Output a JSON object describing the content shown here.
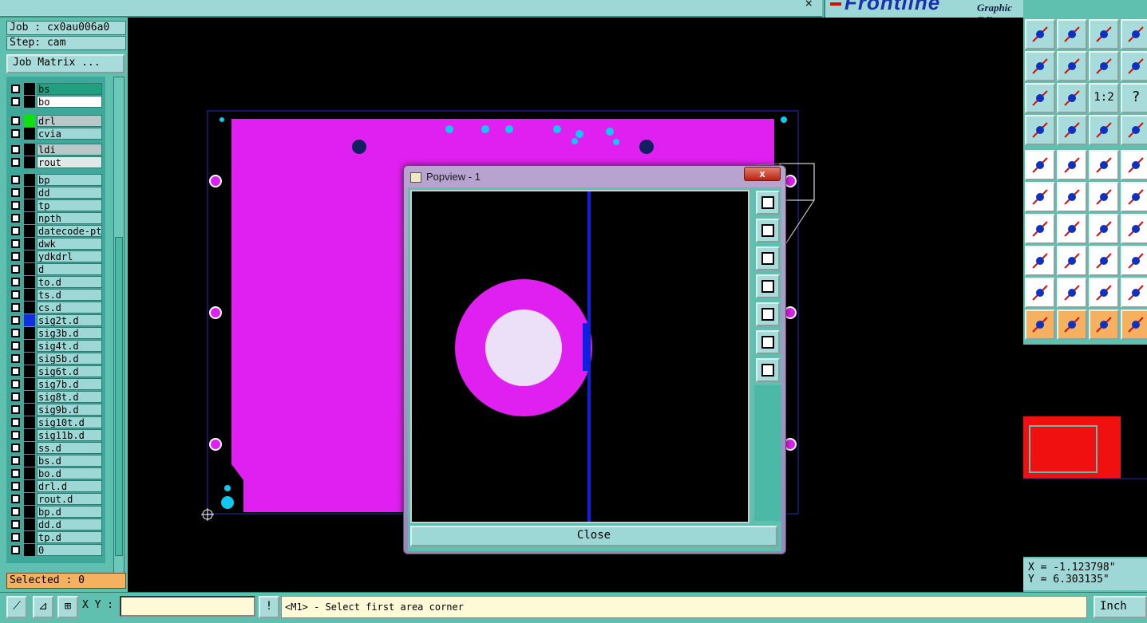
{
  "app": {
    "brand": "Frontline",
    "subtitle": "Graphic Editor",
    "window_close": "×"
  },
  "job": {
    "job_line": "Job : cx0au006a0",
    "step_line": "Step: cam",
    "job_matrix_label": "Job Matrix ..."
  },
  "layers": [
    {
      "name": "bs",
      "color": "#000000",
      "highlight": "#20a080"
    },
    {
      "name": "bo",
      "color": "#000000",
      "highlight": "#ffffff"
    },
    {
      "name": "drl",
      "color": "#10e010",
      "highlight": "#b8c8c8"
    },
    {
      "name": "cvia",
      "color": "#000000",
      "highlight": "#9ed8d6"
    },
    {
      "name": "ldi",
      "color": "#000000",
      "highlight": "#b8c8c8"
    },
    {
      "name": "rout",
      "color": "#000000",
      "highlight": "#e0e8e8"
    },
    {
      "name": "bp",
      "color": "#000000"
    },
    {
      "name": "dd",
      "color": "#000000"
    },
    {
      "name": "tp",
      "color": "#000000"
    },
    {
      "name": "npth",
      "color": "#000000"
    },
    {
      "name": "datecode-ptc",
      "color": "#000000"
    },
    {
      "name": "dwk",
      "color": "#000000"
    },
    {
      "name": "ydkdrl",
      "color": "#000000"
    },
    {
      "name": "d",
      "color": "#000000"
    },
    {
      "name": "to.d",
      "color": "#000000"
    },
    {
      "name": "ts.d",
      "color": "#000000"
    },
    {
      "name": "cs.d",
      "color": "#000000"
    },
    {
      "name": "sig2t.d",
      "color": "#1030e0"
    },
    {
      "name": "sig3b.d",
      "color": "#000000"
    },
    {
      "name": "sig4t.d",
      "color": "#000000"
    },
    {
      "name": "sig5b.d",
      "color": "#000000"
    },
    {
      "name": "sig6t.d",
      "color": "#000000"
    },
    {
      "name": "sig7b.d",
      "color": "#000000"
    },
    {
      "name": "sig8t.d",
      "color": "#000000"
    },
    {
      "name": "sig9b.d",
      "color": "#000000"
    },
    {
      "name": "sig10t.d",
      "color": "#000000"
    },
    {
      "name": "sig11b.d",
      "color": "#000000"
    },
    {
      "name": "ss.d",
      "color": "#000000"
    },
    {
      "name": "bs.d",
      "color": "#000000"
    },
    {
      "name": "bo.d",
      "color": "#000000"
    },
    {
      "name": "drl.d",
      "color": "#000000"
    },
    {
      "name": "rout.d",
      "color": "#000000"
    },
    {
      "name": "bp.d",
      "color": "#000000"
    },
    {
      "name": "dd.d",
      "color": "#000000"
    },
    {
      "name": "tp.d",
      "color": "#000000"
    },
    {
      "name": "0",
      "color": "#000000"
    }
  ],
  "selection": {
    "label": "Selected : 0"
  },
  "popview": {
    "title": "Popview - 1",
    "close_x": "x",
    "close_label": "Close",
    "tools": [
      "zoom-window-icon",
      "pan-up-icon",
      "pan-down-icon",
      "pan-left-icon",
      "pan-right-icon",
      "zoom-fit-icon",
      "zoom-center-icon"
    ]
  },
  "toolbar": {
    "icons": [
      "move-up-icon",
      "move-down-icon",
      "home-icon",
      "split-view-icon",
      "move-left-icon",
      "move-right-icon",
      "undo-icon",
      "reroute-icon",
      "zoom-out-icon",
      "zoom-in-icon",
      "scale-1-2-icon",
      "help-icon",
      "measure-icon",
      "probe-icon",
      "traffic-light-icon",
      "traffic-light-2-icon",
      "add-pad-icon",
      "add-line-icon",
      "ruler-icon",
      "circle-icon",
      "connect-icon",
      "cross-icon",
      "edit-node-icon",
      "delete-node-icon",
      "angle-icon",
      "diagonal-icon",
      "rotate-icon",
      "mirror-icon",
      "snap-icon",
      "align-icon",
      "resize-icon",
      "group-icon",
      "triangle-small-icon",
      "triangle-icon",
      "triangle-bold-icon",
      "triangle-blue-icon",
      "select-icon",
      "select-box-icon",
      "select-diamond-icon",
      "select-path-icon"
    ],
    "scale_label": "1:2",
    "help_label": "?"
  },
  "coords": {
    "x": "X = -1.123798\"",
    "y": "Y =  6.303135\""
  },
  "statusbar": {
    "xy_label": "X Y :",
    "xy_value": "",
    "warn_label": "!",
    "message": "<M1> - Select first area corner",
    "unit": "Inch"
  },
  "colors": {
    "board": "#e020f0",
    "pad": "#10c8f0",
    "trace": "#1020e0",
    "panel": "#5fc0b0"
  }
}
